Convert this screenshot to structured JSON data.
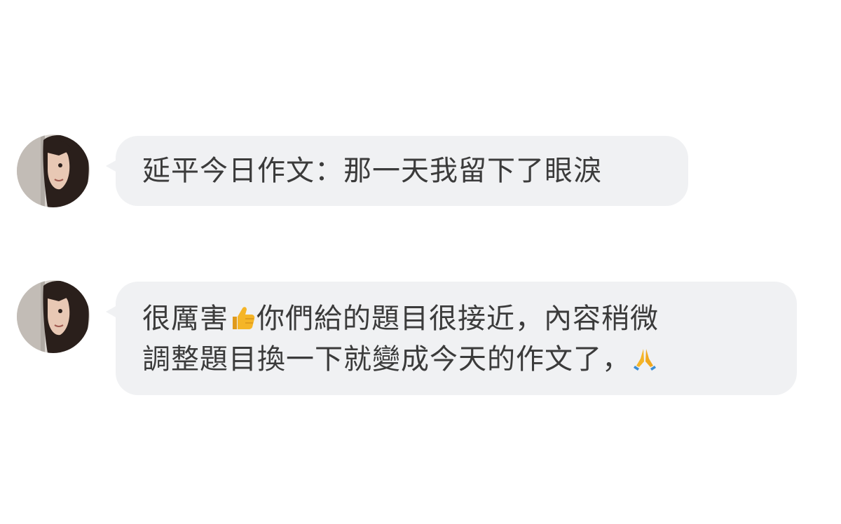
{
  "messages": [
    {
      "text": "延平今日作文：那一天我留下了眼淚"
    },
    {
      "line1_part1": "很厲害",
      "line1_emoji": "thumbs-up-emoji",
      "line1_part2": "你們給的題目很接近，內容稍微",
      "line2_part1": "調整題目換一下就變成今天的作文了，",
      "line2_emoji": "folded-hands-emoji"
    }
  ],
  "colors": {
    "bubble_bg": "#f0f1f3",
    "text": "#3b3b3b",
    "emoji": "#f5b528"
  }
}
